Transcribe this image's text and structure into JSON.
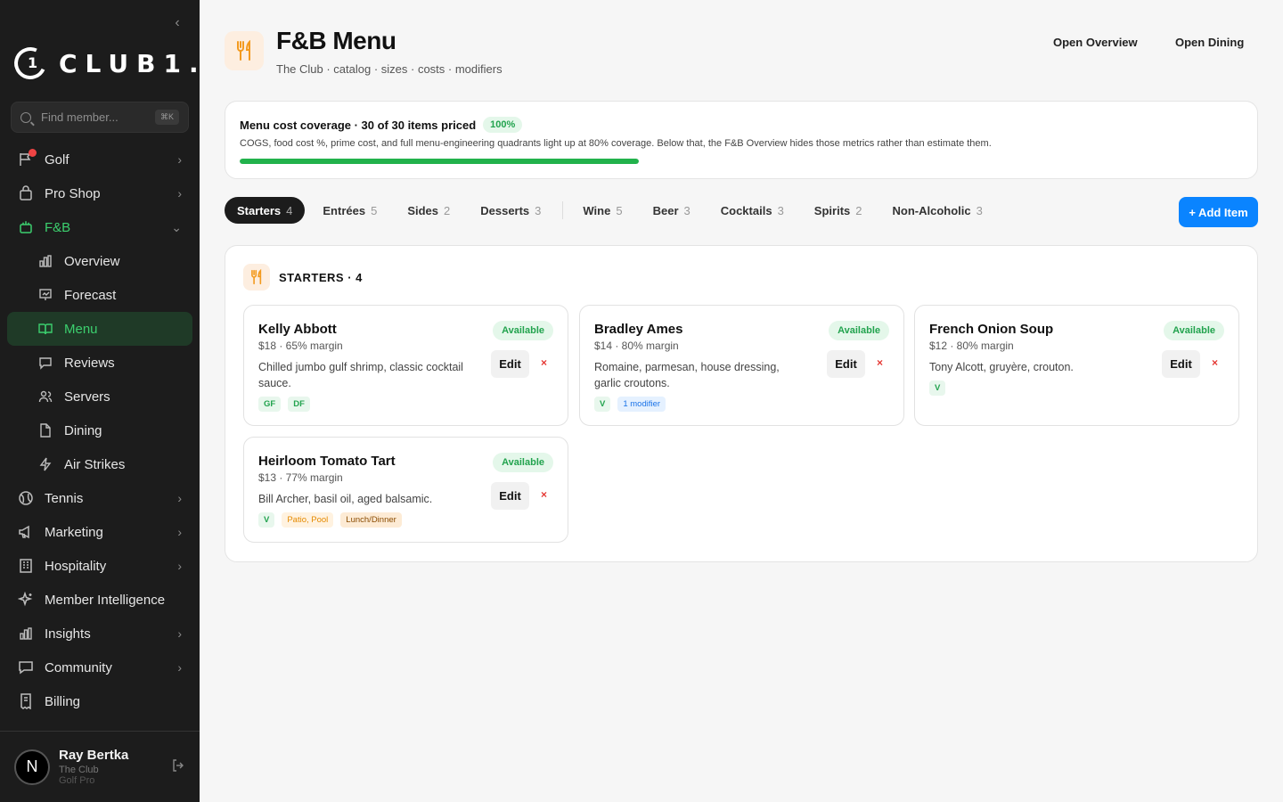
{
  "sidebar": {
    "logo_mark": "1",
    "logo_text": "CLUB1.",
    "search": {
      "placeholder": "Find member...",
      "shortcut": "⌘K"
    },
    "nav": [
      {
        "label": "Golf",
        "icon": "flag-icon",
        "chevron": "›",
        "badge": true
      },
      {
        "label": "Pro Shop",
        "icon": "bag-icon",
        "chevron": "›"
      },
      {
        "label": "F&B",
        "icon": "cutlery-icon",
        "chevron": "⌄",
        "open": true
      },
      {
        "label": "Overview",
        "icon": "bar-chart-icon",
        "sub": true
      },
      {
        "label": "Forecast",
        "icon": "presentation-icon",
        "sub": true
      },
      {
        "label": "Menu",
        "icon": "book-open-icon",
        "sub": true,
        "active": true
      },
      {
        "label": "Reviews",
        "icon": "message-icon",
        "sub": true
      },
      {
        "label": "Servers",
        "icon": "users-icon",
        "sub": true
      },
      {
        "label": "Dining",
        "icon": "document-icon",
        "sub": true
      },
      {
        "label": "Air Strikes",
        "icon": "bolt-icon",
        "sub": true
      },
      {
        "label": "Tennis",
        "icon": "tennis-ball-icon",
        "chevron": "›"
      },
      {
        "label": "Marketing",
        "icon": "megaphone-icon",
        "chevron": "›"
      },
      {
        "label": "Hospitality",
        "icon": "building-icon",
        "chevron": "›"
      },
      {
        "label": "Member Intelligence",
        "icon": "sparkles-icon"
      },
      {
        "label": "Insights",
        "icon": "bar-chart-icon",
        "chevron": "›"
      },
      {
        "label": "Community",
        "icon": "chat-icon",
        "chevron": "›"
      },
      {
        "label": "Billing",
        "icon": "receipt-icon"
      }
    ],
    "user": {
      "initial": "N",
      "name": "Ray Bertka",
      "club": "The Club",
      "role": "Golf Pro"
    }
  },
  "header": {
    "title": "F&B Menu",
    "subtitle": "The Club · catalog · sizes · costs · modifiers",
    "links": {
      "overview": "Open Overview",
      "dining": "Open Dining"
    }
  },
  "coverage": {
    "title": "Menu cost coverage · 30 of 30 items priced",
    "badge": "100%",
    "progress": 1.0,
    "description": "COGS, food cost %, prime cost, and full menu-engineering quadrants light up at 80% coverage. Below that, the F&B Overview hides those metrics rather than estimate them."
  },
  "tabs": [
    {
      "label": "Starters",
      "count": "4",
      "active": true
    },
    {
      "label": "Entrées",
      "count": "5"
    },
    {
      "label": "Sides",
      "count": "2"
    },
    {
      "label": "Desserts",
      "count": "3"
    },
    {
      "label": "Wine",
      "count": "5"
    },
    {
      "label": "Beer",
      "count": "3"
    },
    {
      "label": "Cocktails",
      "count": "3"
    },
    {
      "label": "Spirits",
      "count": "2"
    },
    {
      "label": "Non-Alcoholic",
      "count": "3"
    }
  ],
  "add_button": "+ Add Item",
  "section": {
    "title": "STARTERS · 4",
    "items": [
      {
        "name": "Kelly Abbott",
        "price": "$18 · 65% margin",
        "description": "Chilled jumbo gulf shrimp, classic cocktail sauce.",
        "status": "Available",
        "tags": [
          {
            "text": "GF",
            "style": "green"
          },
          {
            "text": "DF",
            "style": "green"
          }
        ]
      },
      {
        "name": "Bradley Ames",
        "price": "$14 · 80% margin",
        "description": "Romaine, parmesan, house dressing, garlic croutons.",
        "status": "Available",
        "tags": [
          {
            "text": "V",
            "style": "green"
          },
          {
            "text": "1 modifier",
            "style": "blue"
          }
        ]
      },
      {
        "name": "French Onion Soup",
        "price": "$12 · 80% margin",
        "description": "Tony Alcott, gruyère, crouton.",
        "status": "Available",
        "tags": [
          {
            "text": "V",
            "style": "green"
          }
        ]
      },
      {
        "name": "Heirloom Tomato Tart",
        "price": "$13 · 77% margin",
        "description": "Bill Archer, basil oil, aged balsamic.",
        "status": "Available",
        "tags": [
          {
            "text": "V",
            "style": "green"
          },
          {
            "text": "Patio, Pool",
            "style": "orange"
          },
          {
            "text": "Lunch/Dinner",
            "style": "brown"
          }
        ]
      }
    ],
    "edit_label": "Edit",
    "delete_label": "×"
  },
  "colors": {
    "accent": "#0a84ff",
    "success": "#22b24c",
    "sidebar": "#1c1c1c",
    "active_nav": "#3ccf6e",
    "warm": "#e58a00"
  }
}
